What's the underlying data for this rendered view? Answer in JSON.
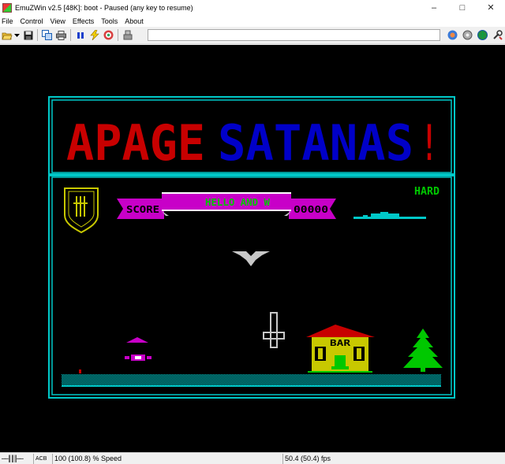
{
  "window": {
    "title": "EmuZWin v2.5 [48K]: boot - Paused (any key to resume)",
    "controls": {
      "minimize": "–",
      "maximize": "□",
      "close": "✕"
    }
  },
  "menu": {
    "items": [
      {
        "label": "File"
      },
      {
        "label": "Control"
      },
      {
        "label": "View"
      },
      {
        "label": "Effects"
      },
      {
        "label": "Tools"
      },
      {
        "label": "About"
      }
    ]
  },
  "toolbar": {
    "left_icons": [
      "open-icon",
      "dropdown-arrow-icon",
      "save-icon",
      "copy-icon",
      "print-icon",
      "pause-icon",
      "lightning-icon",
      "sound-icon",
      "tape-icon"
    ],
    "right_icons": [
      "joystick-icon",
      "settings-icon",
      "globe-icon",
      "tools-icon"
    ],
    "field_value": ""
  },
  "game": {
    "title_word1": "APAGE",
    "title_word2": "SATANAS",
    "title_excl": "!",
    "difficulty": "HARD",
    "score_label": "SCORE",
    "scroll_message": "HELLO AND W",
    "score_value": "00000",
    "bar_sign": "BAR",
    "colors": {
      "border": "#00c8c8",
      "title_red": "#c80000",
      "title_blue": "#0000c8",
      "magenta": "#c800c8",
      "green": "#00c800",
      "yellow": "#c8c800",
      "white": "#c8c8c8",
      "cyan": "#00c8c8"
    }
  },
  "statusbar": {
    "tape_indicator": "──║║║──",
    "acb": "ACB",
    "speed": "100 (100.8) % Speed",
    "fps": "50.4 (50.4) fps"
  }
}
